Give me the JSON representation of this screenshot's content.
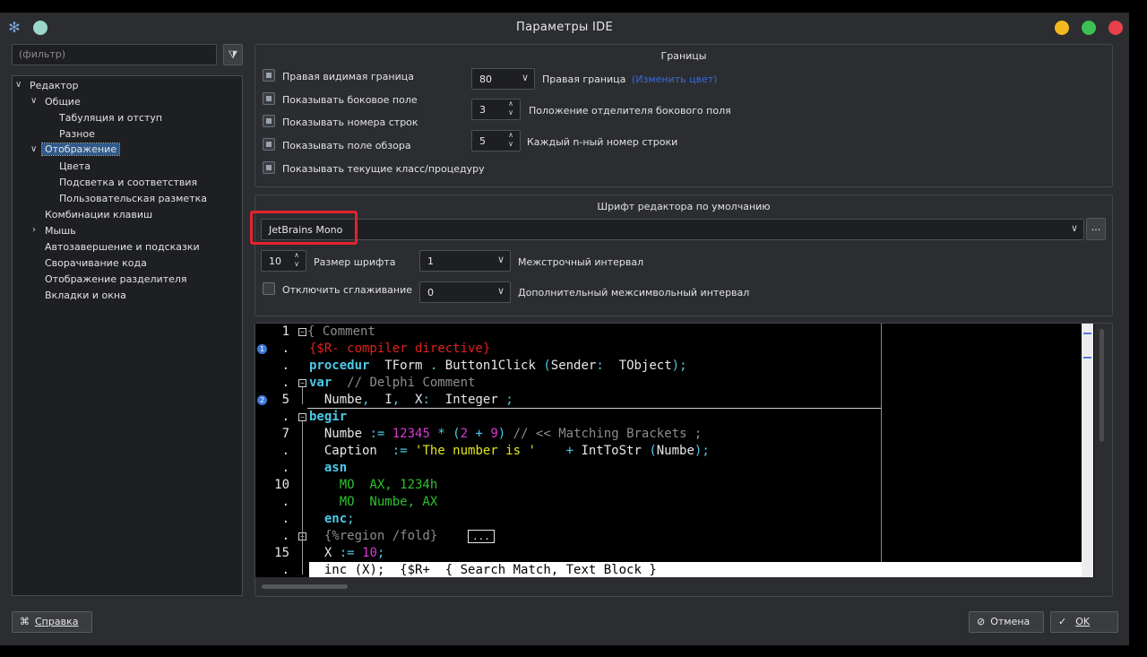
{
  "window": {
    "title": "Параметры IDE"
  },
  "filter": {
    "placeholder": "(фильтр)",
    "button_icon": "filter-icon"
  },
  "tree": {
    "items": [
      {
        "label": "Редактор",
        "expanded": true
      },
      {
        "label": "Общие",
        "expanded": true
      },
      {
        "label": "Табуляция и отступ"
      },
      {
        "label": "Разное"
      },
      {
        "label": "Отображение",
        "expanded": true,
        "selected": true
      },
      {
        "label": "Цвета"
      },
      {
        "label": "Подсветка и соответствия"
      },
      {
        "label": "Пользовательская разметка"
      },
      {
        "label": "Комбинации клавиш"
      },
      {
        "label": "Мышь",
        "expanded": false
      },
      {
        "label": "Автозавершение и подсказки"
      },
      {
        "label": "Сворачивание кода"
      },
      {
        "label": "Отображение разделителя"
      },
      {
        "label": "Вкладки и окна"
      }
    ]
  },
  "margins": {
    "title": "Границы",
    "checkboxes": [
      {
        "label": "Правая видимая граница",
        "checked": true
      },
      {
        "label": "Показывать боковое поле",
        "checked": true
      },
      {
        "label": "Показывать номера строк",
        "checked": true
      },
      {
        "label": "Показывать поле обзора",
        "checked": true
      },
      {
        "label": "Показывать текущие класс/процедуру",
        "checked": true
      }
    ],
    "right_margin_value": "80",
    "right_margin_label": "Правая граница",
    "right_margin_link": "(Изменить цвет)",
    "gutter_sep_value": "3",
    "gutter_sep_label": "Положение отделителя бокового поля",
    "every_nth_value": "5",
    "every_nth_label": "Каждый n-ный номер строки"
  },
  "font": {
    "title": "Шрифт редактора по умолчанию",
    "family": "JetBrains Mono",
    "browse_label": "...",
    "size_value": "10",
    "size_label": "Размер шрифта",
    "line_spacing_value": "1",
    "line_spacing_label": "Межстрочный интервал",
    "disable_aa_label": "Отключить сглаживание",
    "disable_aa_checked": false,
    "char_spacing_value": "0",
    "char_spacing_label": "Дополнительный межсимвольный интервал"
  },
  "preview": {
    "gutter": [
      "1",
      ".",
      ".",
      ".",
      "5",
      ".",
      "7",
      ".",
      ".",
      "10",
      ".",
      ".",
      ".",
      "15",
      "."
    ],
    "bookmarks": [
      "1",
      "2"
    ],
    "lines": [
      [
        {
          "t": "{ Comment",
          "c": "#8c8c8c"
        }
      ],
      [
        {
          "t": "{$R- compiler directive}",
          "c": "#e0201c"
        }
      ],
      [
        {
          "t": "procedur",
          "c": "#4ec9e8",
          "b": true
        },
        {
          "t": "  TForm",
          "c": "#e8e8e8"
        },
        {
          "t": " . ",
          "c": "#4ec9e8"
        },
        {
          "t": "Button1Click",
          "c": "#e8e8e8"
        },
        {
          "t": " (",
          "c": "#4ec9e8"
        },
        {
          "t": "Sender",
          "c": "#e8e8e8"
        },
        {
          "t": ":  ",
          "c": "#4ec9e8"
        },
        {
          "t": "TObject",
          "c": "#e8e8e8"
        },
        {
          "t": ");",
          "c": "#4ec9e8"
        }
      ],
      [
        {
          "t": "var",
          "c": "#4ec9e8",
          "b": true
        },
        {
          "t": "  // Delphi Comment",
          "c": "#8c8c8c"
        }
      ],
      [
        {
          "t": "  Numbe",
          "c": "#e8e8e8"
        },
        {
          "t": ",  ",
          "c": "#4ec9e8"
        },
        {
          "t": "I",
          "c": "#e8e8e8"
        },
        {
          "t": ",  ",
          "c": "#4ec9e8"
        },
        {
          "t": "X",
          "c": "#e8e8e8"
        },
        {
          "t": ":  ",
          "c": "#4ec9e8"
        },
        {
          "t": "Integer",
          "c": "#e8e8e8"
        },
        {
          "t": " ;",
          "c": "#4ec9e8"
        }
      ],
      [
        {
          "t": "begir",
          "c": "#4ec9e8",
          "b": true
        }
      ],
      [
        {
          "t": "  Numbe",
          "c": "#e8e8e8"
        },
        {
          "t": " := ",
          "c": "#4ec9e8"
        },
        {
          "t": "12345",
          "c": "#d63ad6"
        },
        {
          "t": " * (",
          "c": "#4ec9e8"
        },
        {
          "t": "2",
          "c": "#d63ad6"
        },
        {
          "t": " + ",
          "c": "#4ec9e8"
        },
        {
          "t": "9",
          "c": "#d63ad6"
        },
        {
          "t": ")",
          "c": "#4ec9e8"
        },
        {
          "t": " // << Matching Brackets ;",
          "c": "#8c8c8c"
        }
      ],
      [
        {
          "t": "  Caption",
          "c": "#e8e8e8"
        },
        {
          "t": "  := ",
          "c": "#4ec9e8"
        },
        {
          "t": "'The number is '",
          "c": "#e6e61a"
        },
        {
          "t": "    + ",
          "c": "#4ec9e8"
        },
        {
          "t": "IntToStr",
          "c": "#e8e8e8"
        },
        {
          "t": " (",
          "c": "#4ec9e8"
        },
        {
          "t": "Numbe",
          "c": "#e8e8e8"
        },
        {
          "t": ");",
          "c": "#4ec9e8"
        }
      ],
      [
        {
          "t": "  asn",
          "c": "#4ec9e8",
          "b": true
        }
      ],
      [
        {
          "t": "    MO  A",
          "c": "#2ec02e"
        },
        {
          "t": "X, 1234h",
          "c": "#2ec02e"
        }
      ],
      [
        {
          "t": "    MO  Numbe, AX",
          "c": "#2ec02e"
        }
      ],
      [
        {
          "t": "  enc",
          "c": "#4ec9e8",
          "b": true
        },
        {
          "t": ";",
          "c": "#4ec9e8"
        }
      ],
      [
        {
          "t": "  {%region /fold}",
          "c": "#8c8c8c"
        },
        {
          "t": "    ",
          "c": "#e8e8e8"
        },
        {
          "t": "...",
          "c": "#e8e8e8",
          "box": true
        }
      ],
      [
        {
          "t": "  X",
          "c": "#e8e8e8"
        },
        {
          "t": " := ",
          "c": "#4ec9e8"
        },
        {
          "t": "10",
          "c": "#d63ad6"
        },
        {
          "t": ";",
          "c": "#4ec9e8"
        }
      ],
      [
        {
          "t": "  inc",
          "c": "#000"
        },
        {
          "t": " (",
          "c": "#000"
        },
        {
          "t": "X",
          "c": "#000"
        },
        {
          "t": ");  {$R+  { Search Match, Text Block }",
          "c": "#000"
        }
      ]
    ]
  },
  "footer": {
    "help_label": "Справка",
    "help_icon": "help-icon",
    "cancel_label": "Отмена",
    "cancel_icon": "cancel-icon",
    "ok_label": "OK",
    "ok_icon": "check-icon"
  }
}
